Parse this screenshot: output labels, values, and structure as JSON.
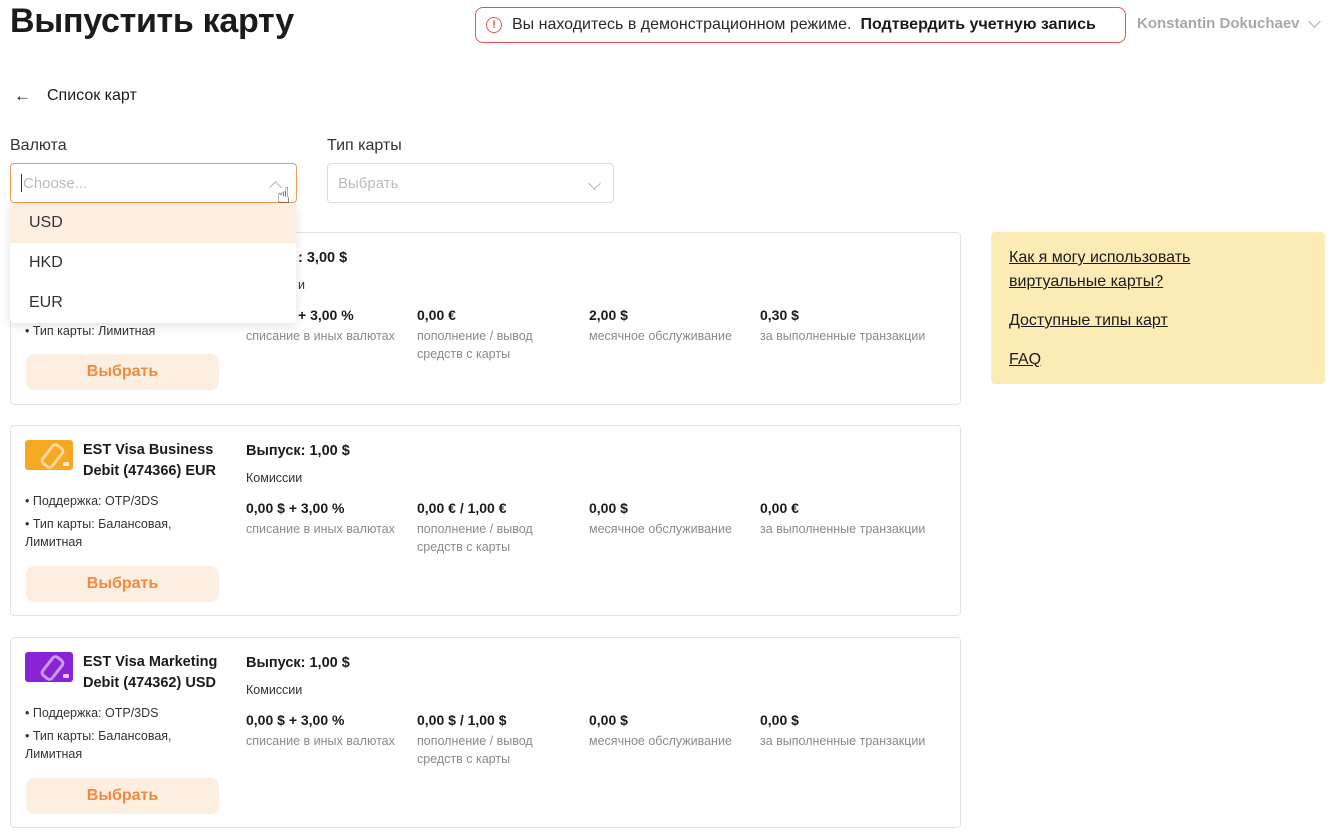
{
  "header": {
    "title": "Выпустить карту",
    "demo_banner": {
      "text": "Вы находитесь в демонстрационном режиме.",
      "link": "Подтвердить учетную запись",
      "icon": "alert-circle-icon",
      "color": "#e4534f"
    },
    "user_name": "Konstantin Dokuchaev"
  },
  "back_link": {
    "label": "Список карт",
    "icon": "arrow-left-icon"
  },
  "filters": {
    "currency": {
      "label": "Валюта",
      "placeholder": "Choose...",
      "options": [
        "USD",
        "HKD",
        "EUR"
      ],
      "highlighted": "USD"
    },
    "card_type": {
      "label": "Тип карты",
      "placeholder": "Выбрать"
    }
  },
  "cards": [
    {
      "bullet_type": "• Тип карты: Лимитная",
      "issue_partial": ": 3,00 $",
      "commissions_partial": "и",
      "fees": [
        {
          "value": "+ 3,00 %",
          "label": "списание в иных валютах"
        },
        {
          "value": "0,00 €",
          "label": "пополнение / вывод средств с карты"
        },
        {
          "value": "2,00 $",
          "label": "месячное обслуживание"
        },
        {
          "value": "0,30 $",
          "label": "за выполненные транзакции"
        }
      ],
      "button": "Выбрать"
    },
    {
      "name": "EST Visa Business Debit (474366) EUR",
      "thumb_color": "#f7a823",
      "bullet_support": "• Поддержка: OTP/3DS",
      "bullet_type": "• Тип карты: Балансовая, Лимитная",
      "issue": "Выпуск: 1,00 $",
      "commissions": "Комиссии",
      "fees": [
        {
          "value": "0,00 $ + 3,00 %",
          "label": "списание в иных валютах"
        },
        {
          "value": "0,00 € / 1,00 €",
          "label": "пополнение / вывод средств с карты"
        },
        {
          "value": "0,00 $",
          "label": "месячное обслуживание"
        },
        {
          "value": "0,00 €",
          "label": "за выполненные транзакции"
        }
      ],
      "button": "Выбрать"
    },
    {
      "name": "EST Visa Marketing Debit (474362) USD",
      "thumb_color": "#8a22d6",
      "bullet_support": "• Поддержка: OTP/3DS",
      "bullet_type": "• Тип карты: Балансовая, Лимитная",
      "issue": "Выпуск: 1,00 $",
      "commissions": "Комиссии",
      "fees": [
        {
          "value": "0,00 $ + 3,00 %",
          "label": "списание в иных валютах"
        },
        {
          "value": "0,00 $ / 1,00 $",
          "label": "пополнение / вывод средств с карты"
        },
        {
          "value": "0,00 $",
          "label": "месячное обслуживание"
        },
        {
          "value": "0,00 $",
          "label": "за выполненные транзакции"
        }
      ],
      "button": "Выбрать"
    }
  ],
  "faq": {
    "links": [
      "Как я могу использовать виртуальные карты?",
      "Доступные типы карт",
      "FAQ"
    ]
  },
  "accent_color": "#f08a3c"
}
